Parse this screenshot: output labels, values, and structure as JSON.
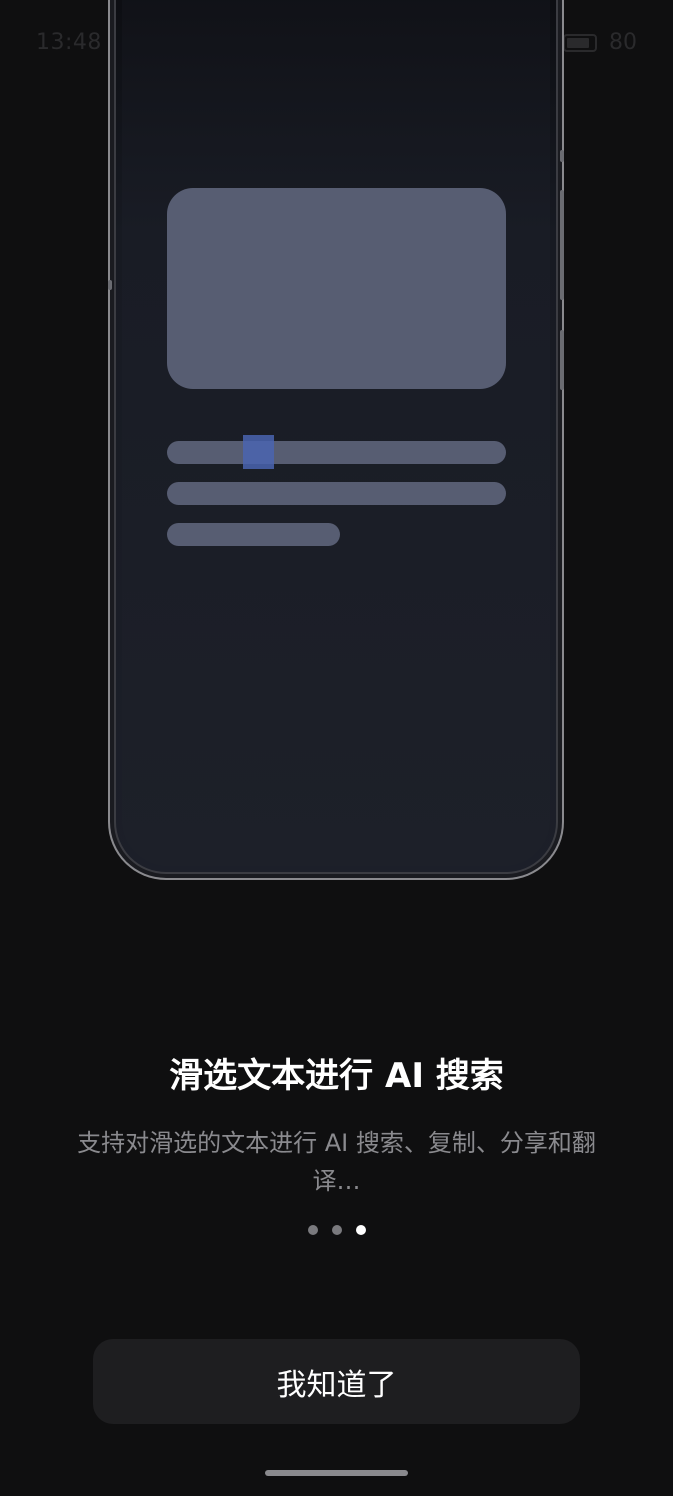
{
  "status_bar": {
    "time": "13:48",
    "battery": "80"
  },
  "onboarding": {
    "title": "滑选文本进行 AI 搜索",
    "description": "支持对滑选的文本进行 AI 搜索、复制、分享和翻译…",
    "page_indicator": {
      "total": 3,
      "current": 3
    },
    "confirm_label": "我知道了"
  },
  "colors": {
    "background": "#0f0f10",
    "placeholder": "#575d72",
    "selection": "#4a64b0",
    "button_bg": "#1e1e20"
  }
}
